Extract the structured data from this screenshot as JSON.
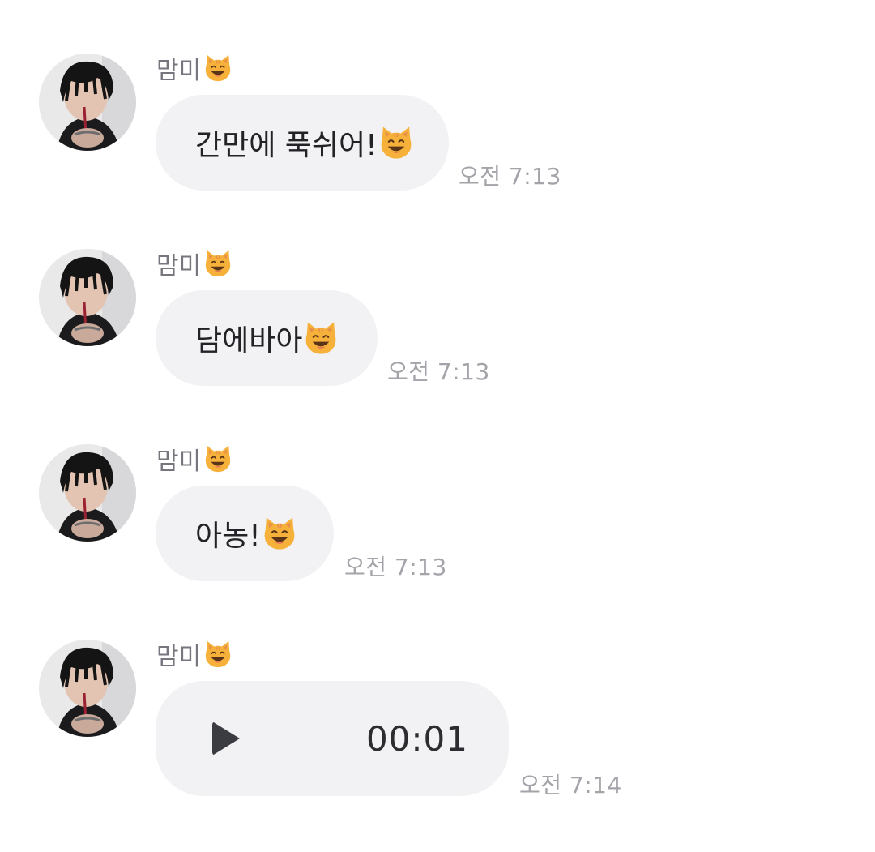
{
  "messages": [
    {
      "sender": "맘미",
      "text": "간만에 푹쉬어!",
      "time": "오전 7:13"
    },
    {
      "sender": "맘미",
      "text": "담에바아",
      "time": "오전 7:13"
    },
    {
      "sender": "맘미",
      "text": "아농!",
      "time": "오전 7:13"
    },
    {
      "sender": "맘미",
      "voice_duration": "00:01",
      "time": "오전 7:14"
    }
  ],
  "icons": {
    "name_emoji": "grinning-cat-emoji",
    "message_emoji": "grinning-cat-emoji",
    "play": "play-icon"
  }
}
